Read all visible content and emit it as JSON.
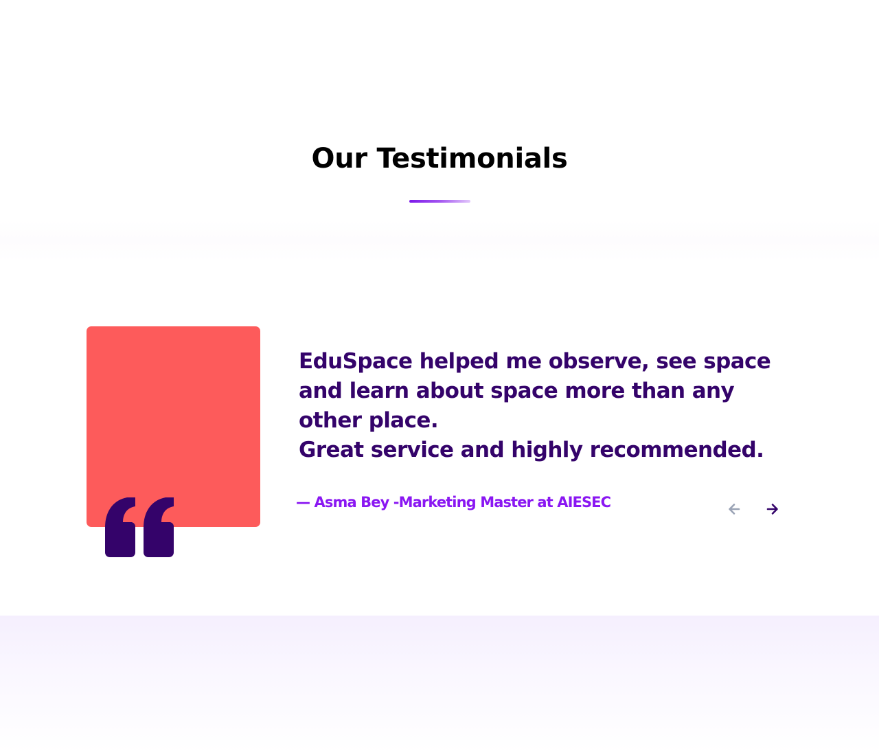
{
  "section": {
    "title": "Our Testimonials"
  },
  "testimonial": {
    "quote_lines": [
      "EduSpace helped me observe, see space",
      "and learn about space more than any",
      "other place.",
      "Great service and highly recommended."
    ],
    "author": "— Asma Bey -Marketing Master at AIESEC",
    "photo_placeholder_color": "#fd5b5b",
    "quote_icon": "quote-icon"
  },
  "navigation": {
    "prev_icon": "arrow-left-icon",
    "next_icon": "arrow-right-icon"
  },
  "colors": {
    "heading": "#000000",
    "quote_text": "#34036a",
    "author": "#8a17f2",
    "accent": "#7c19e9",
    "nav_disabled": "#9aa3b5",
    "nav_active": "#34036a"
  }
}
